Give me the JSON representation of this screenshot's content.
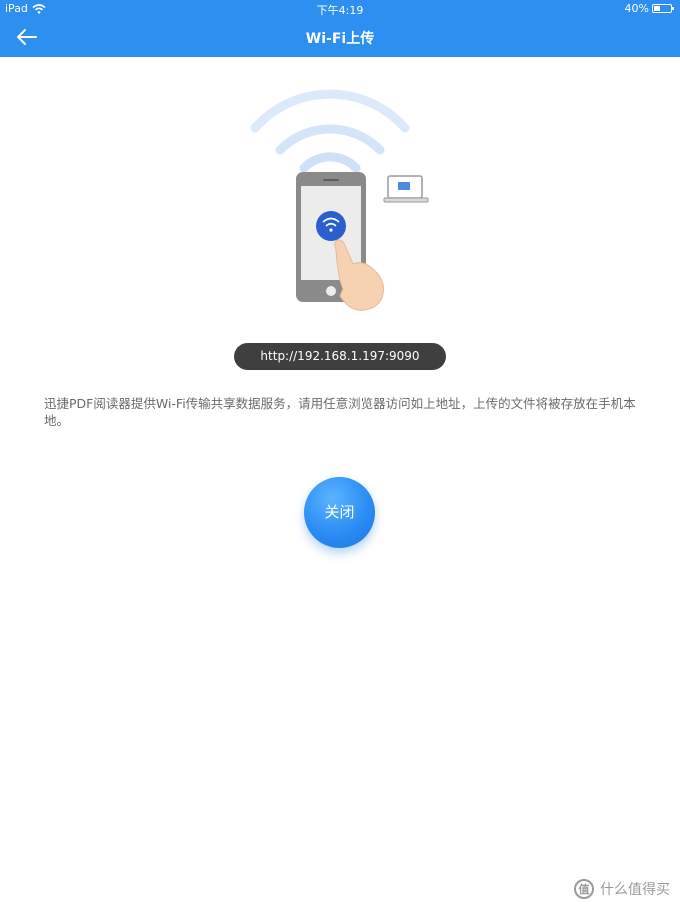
{
  "status_bar": {
    "carrier": "iPad",
    "time": "下午4:19",
    "battery": "40%",
    "battery_level": 0.4
  },
  "nav": {
    "title": "Wi-Fi上传",
    "back_icon": "arrow-left-icon"
  },
  "illustration": {
    "name": "wifi-phone-transfer-illustration",
    "colors": {
      "waves": "#d8e8fa",
      "phone": "#8a8a8a",
      "wifi_button": "#2b6fd6"
    }
  },
  "server_address": "http://192.168.1.197:9090",
  "description": "迅捷PDF阅读器提供Wi-Fi传输共享数据服务，请用任意浏览器访问如上地址，上传的文件将被存放在手机本地。",
  "close_button": "关闭",
  "watermark": {
    "logo": "值",
    "text": "什么值得买"
  },
  "colors": {
    "accent": "#2d8ff0",
    "pill": "#3f3f3f",
    "text_gray": "#6a6a6a"
  }
}
